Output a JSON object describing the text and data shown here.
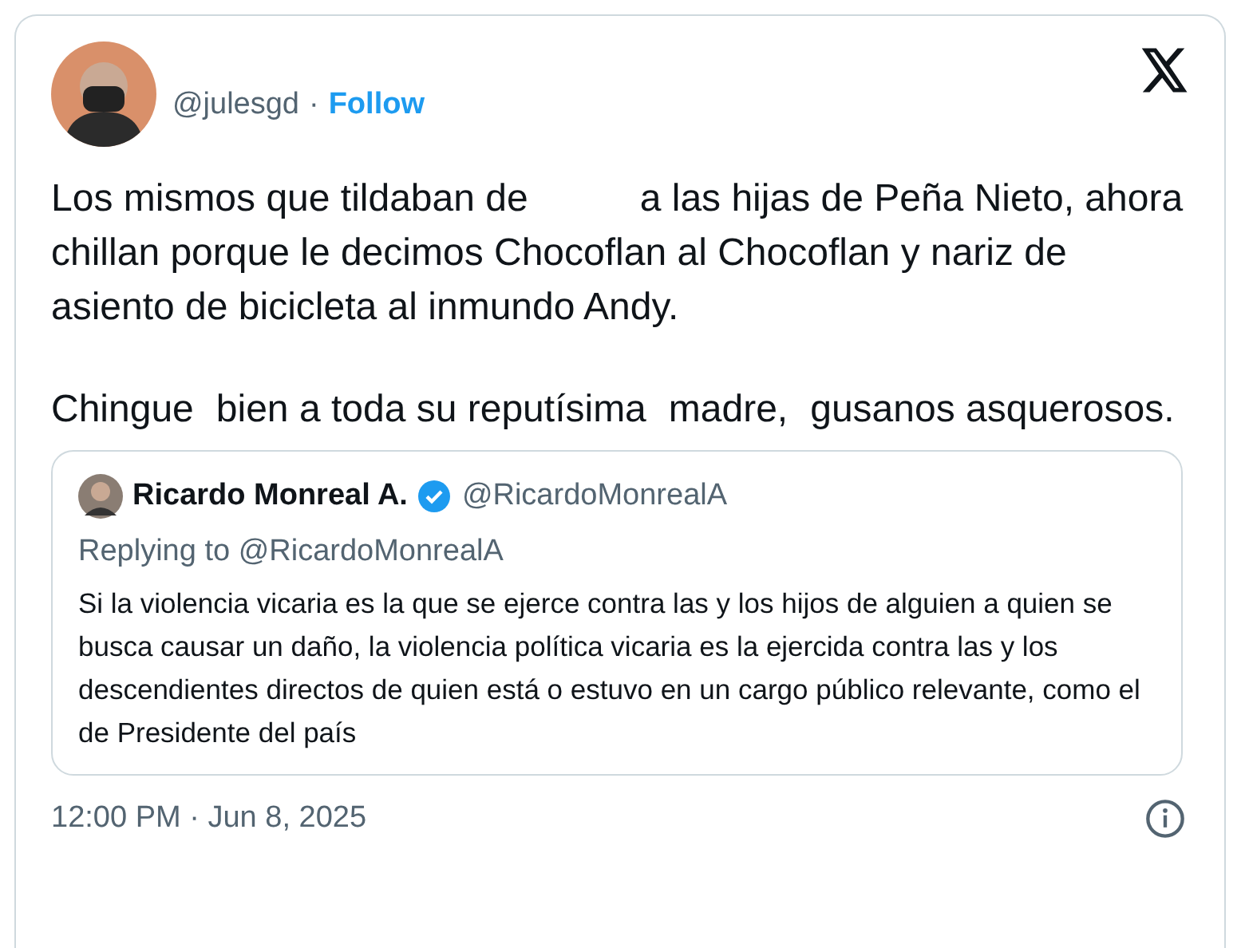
{
  "author": {
    "handle": "@julesgd",
    "separator": "·",
    "follow": "Follow"
  },
  "body": [
    {
      "parts": [
        "Los mismos que tildaban de",
        "a las hijas de Peña Nieto, ahora chillan porque le decimos Chocoflan al Chocoflan y nariz de asiento de bicicleta al inmundo Andy."
      ]
    },
    {
      "parts": [
        "Chingue",
        "bien a toda su reputísima",
        "madre,",
        "gusanos asquerosos."
      ]
    }
  ],
  "quote": {
    "name": "Ricardo Monreal A.",
    "verified": true,
    "handle": "@RicardoMonrealA",
    "replying": "Replying to @RicardoMonrealA",
    "text": "Si la violencia vicaria es la que se ejerce contra las y los hijos de alguien a quien se busca causar un daño, la violencia política vicaria es la ejercida contra las y los descendientes directos de quien está o estuvo en un cargo público relevante, como el de Presidente del país"
  },
  "timestamp": "12:00 PM · Jun 8, 2025"
}
